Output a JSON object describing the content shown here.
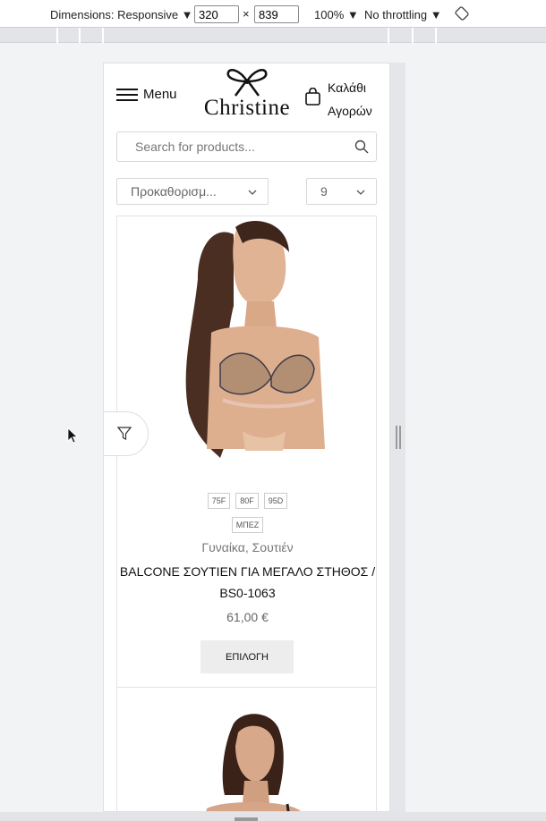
{
  "devtools": {
    "dimensions_label": "Dimensions: Responsive ▼",
    "width": "320",
    "times": "×",
    "height": "839",
    "zoom": "100% ▼",
    "throttling": "No throttling ▼"
  },
  "header": {
    "menu_label": "Menu",
    "logo_text": "Christine",
    "cart_line1": "Καλάθι",
    "cart_line2": "Αγορών"
  },
  "search": {
    "placeholder": "Search for products..."
  },
  "toolbar": {
    "sort_value": "Προκαθορισμ...",
    "per_page_value": "9"
  },
  "product": {
    "sizes_row1": [
      "75F",
      "80F",
      "95D"
    ],
    "colors_row2": [
      "ΜΠΕΖ"
    ],
    "categories": "Γυναίκα, Σουτιέν",
    "title": "BALCONE ΣΟΥΤΙΕΝ ΓΙΑ ΜΕΓΑΛΟ ΣΤΗΘΟΣ / BS0-1063",
    "price": "61,00 €",
    "button_label": "ΕΠΙΛΟΓΗ"
  },
  "colors": {
    "accent": "#111111",
    "button_bg": "#ededed",
    "border": "#d8d8d8"
  }
}
